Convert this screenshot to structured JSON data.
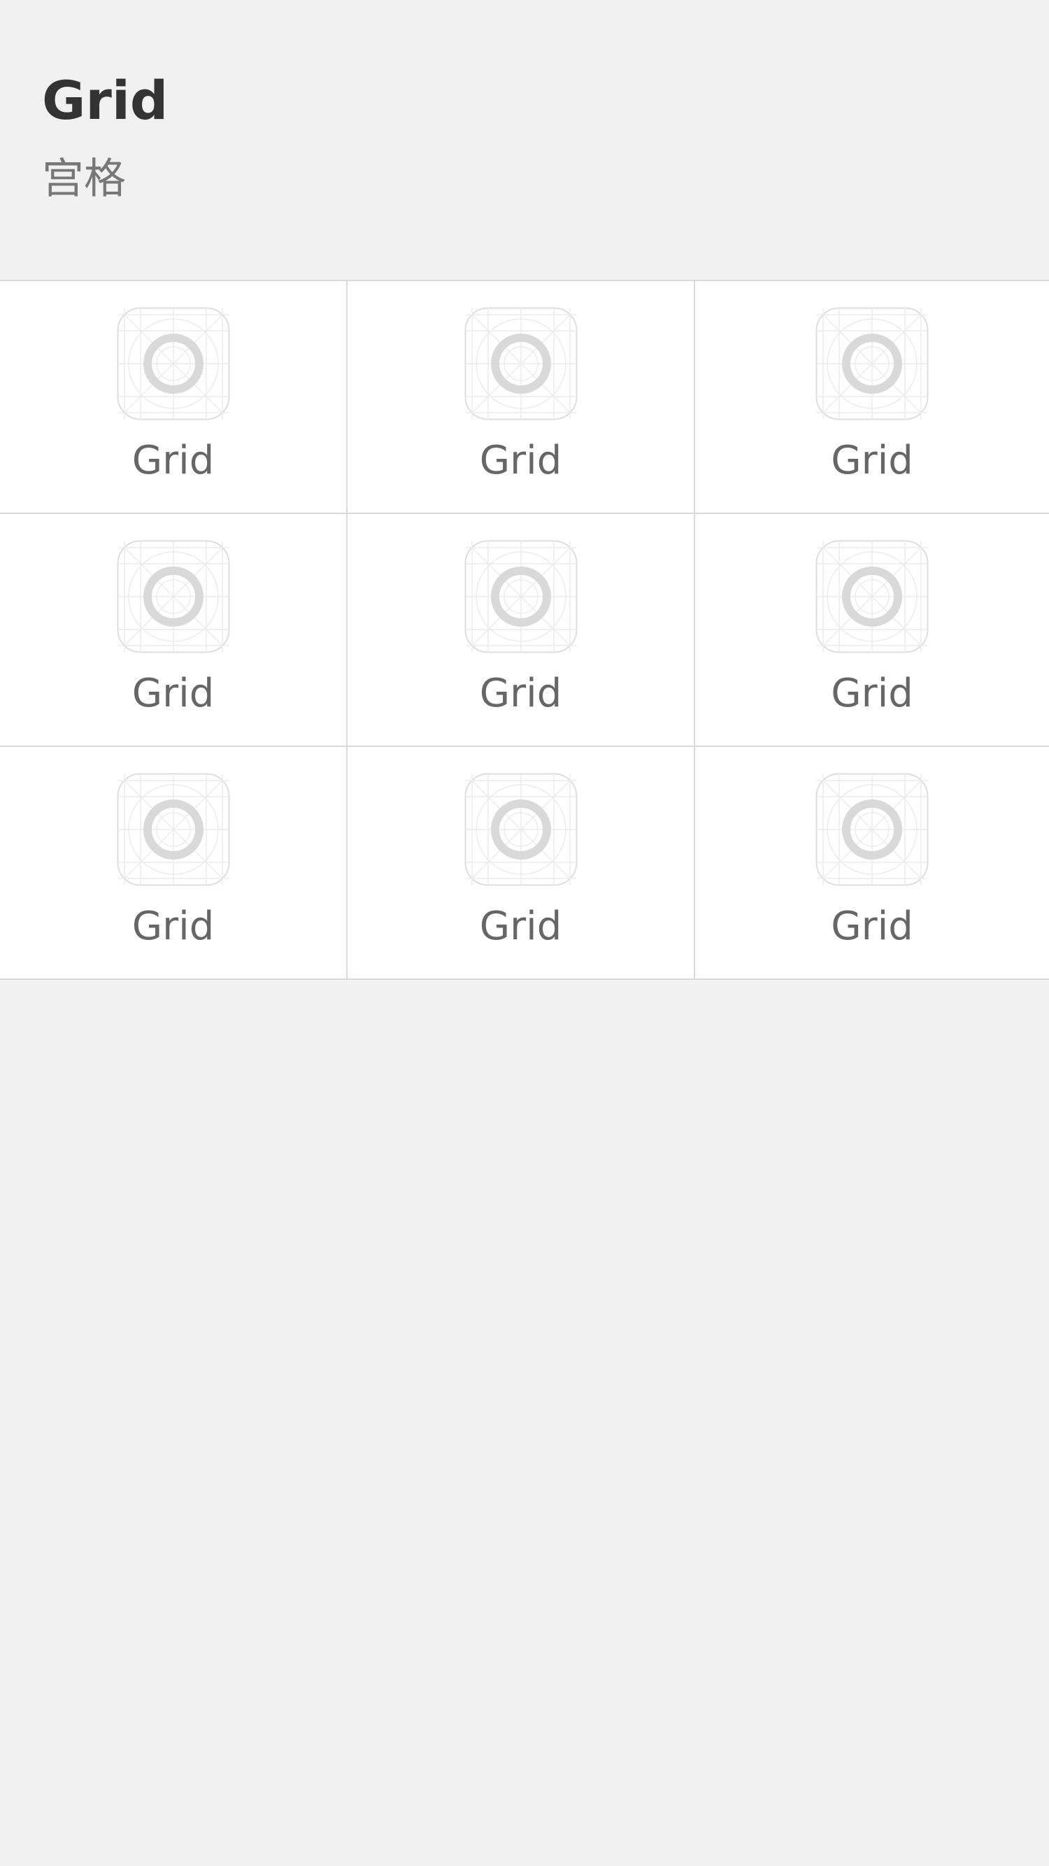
{
  "header": {
    "title": "Grid",
    "subtitle": "宫格"
  },
  "grid": {
    "items": [
      {
        "label": "Grid",
        "icon": "placeholder-icon"
      },
      {
        "label": "Grid",
        "icon": "placeholder-icon"
      },
      {
        "label": "Grid",
        "icon": "placeholder-icon"
      },
      {
        "label": "Grid",
        "icon": "placeholder-icon"
      },
      {
        "label": "Grid",
        "icon": "placeholder-icon"
      },
      {
        "label": "Grid",
        "icon": "placeholder-icon"
      },
      {
        "label": "Grid",
        "icon": "placeholder-icon"
      },
      {
        "label": "Grid",
        "icon": "placeholder-icon"
      },
      {
        "label": "Grid",
        "icon": "placeholder-icon"
      }
    ]
  },
  "colors": {
    "background": "#f1f1f1",
    "cell_background": "#ffffff",
    "divider": "#d9d9d9",
    "title": "#333333",
    "subtitle": "#777777",
    "label": "#666666",
    "icon_ring": "#d9d9d9"
  }
}
